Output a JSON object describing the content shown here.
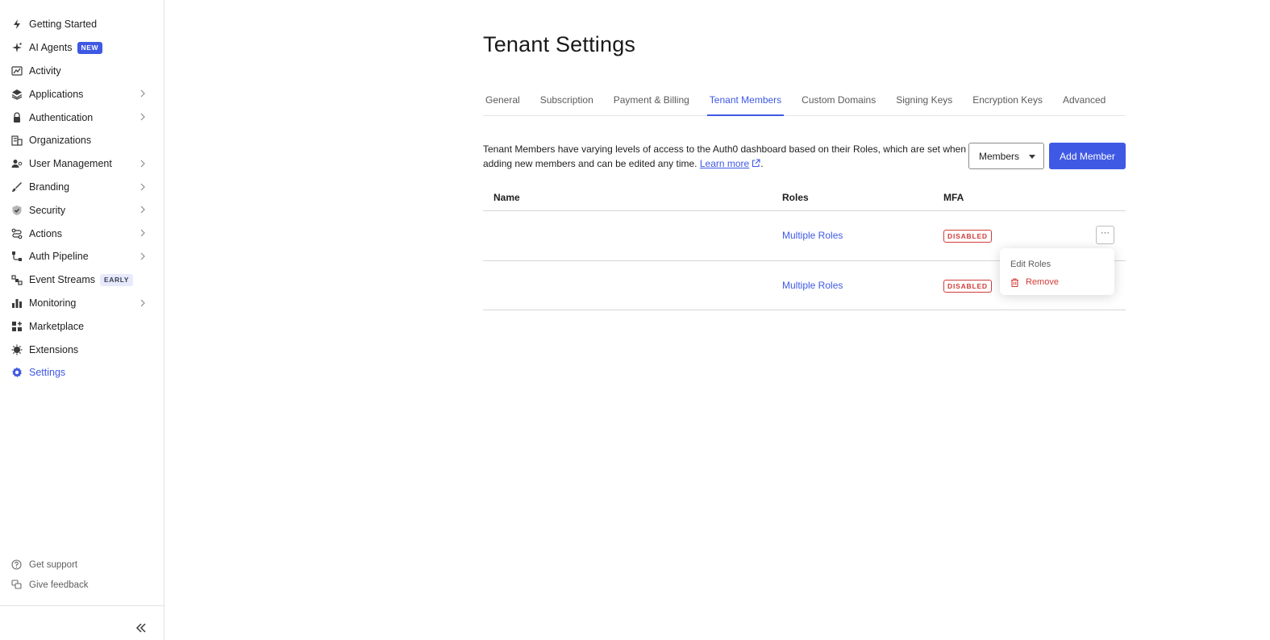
{
  "sidebar": {
    "items": [
      {
        "label": "Getting Started",
        "icon": "bolt-icon"
      },
      {
        "label": "AI Agents",
        "icon": "sparkle-icon",
        "badge": "NEW"
      },
      {
        "label": "Activity",
        "icon": "activity-chart-icon"
      },
      {
        "label": "Applications",
        "icon": "layers-icon",
        "has_children": true
      },
      {
        "label": "Authentication",
        "icon": "lock-icon",
        "has_children": true
      },
      {
        "label": "Organizations",
        "icon": "building-icon"
      },
      {
        "label": "User Management",
        "icon": "users-icon",
        "has_children": true
      },
      {
        "label": "Branding",
        "icon": "brush-icon",
        "has_children": true
      },
      {
        "label": "Security",
        "icon": "shield-icon",
        "has_children": true
      },
      {
        "label": "Actions",
        "icon": "flow-icon",
        "has_children": true
      },
      {
        "label": "Auth Pipeline",
        "icon": "pipeline-icon",
        "has_children": true
      },
      {
        "label": "Event Streams",
        "icon": "streams-icon",
        "badge": "EARLY"
      },
      {
        "label": "Monitoring",
        "icon": "bar-chart-icon",
        "has_children": true
      },
      {
        "label": "Marketplace",
        "icon": "grid-plus-icon"
      },
      {
        "label": "Extensions",
        "icon": "puzzle-icon"
      },
      {
        "label": "Settings",
        "icon": "gear-icon",
        "active": true
      }
    ],
    "footer": {
      "support_label": "Get support",
      "feedback_label": "Give feedback"
    }
  },
  "page": {
    "title": "Tenant Settings",
    "tabs": [
      {
        "label": "General"
      },
      {
        "label": "Subscription"
      },
      {
        "label": "Payment & Billing"
      },
      {
        "label": "Tenant Members",
        "active": true
      },
      {
        "label": "Custom Domains"
      },
      {
        "label": "Signing Keys"
      },
      {
        "label": "Encryption Keys"
      },
      {
        "label": "Advanced"
      }
    ],
    "description": "Tenant Members have varying levels of access to the Auth0 dashboard based on their Roles, which are set when adding new members and can be edited any time.",
    "learn_more": "Learn more",
    "filter_select": "Members",
    "add_button": "Add Member"
  },
  "table": {
    "headers": {
      "name": "Name",
      "roles": "Roles",
      "mfa": "MFA"
    },
    "rows": [
      {
        "name": "",
        "roles": "Multiple Roles",
        "mfa": "DISABLED"
      },
      {
        "name": "",
        "roles": "Multiple Roles",
        "mfa": "DISABLED"
      }
    ]
  },
  "row_menu": {
    "kebab_label": "···",
    "edit_label": "Edit Roles",
    "remove_label": "Remove"
  },
  "colors": {
    "accent": "#3f59e4",
    "danger": "#d03c38"
  }
}
